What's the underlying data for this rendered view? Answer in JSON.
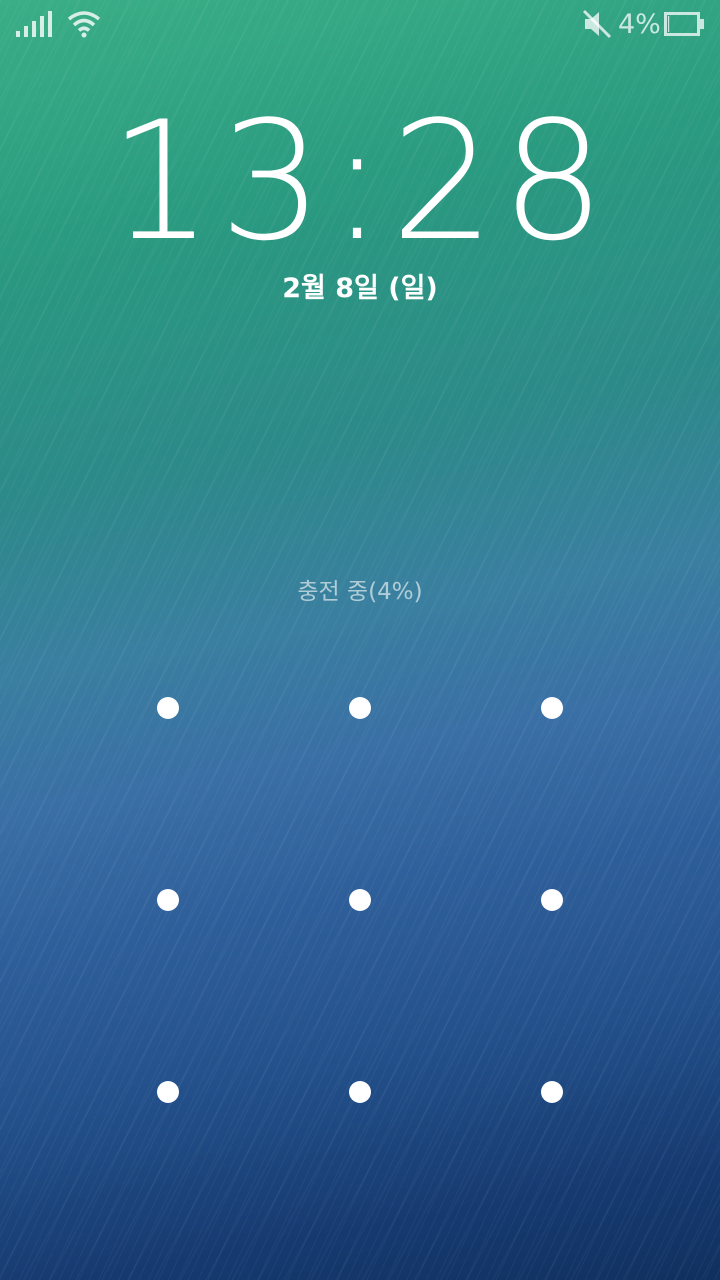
{
  "status_bar": {
    "signal_icon": "signal-icon",
    "wifi_icon": "wifi-icon",
    "mute_icon": "mute-icon",
    "battery_percent": "4%",
    "battery_level": 0.04,
    "battery_icon": "battery-icon"
  },
  "lockscreen": {
    "time": "13:28",
    "date": "2월 8일 (일)",
    "charging_status": "충전 중(4%)"
  },
  "pattern": {
    "rows": 3,
    "cols": 3,
    "dot_color": "#ffffff"
  },
  "colors": {
    "gradient_top": "#3aae86",
    "gradient_bottom": "#10305f"
  }
}
